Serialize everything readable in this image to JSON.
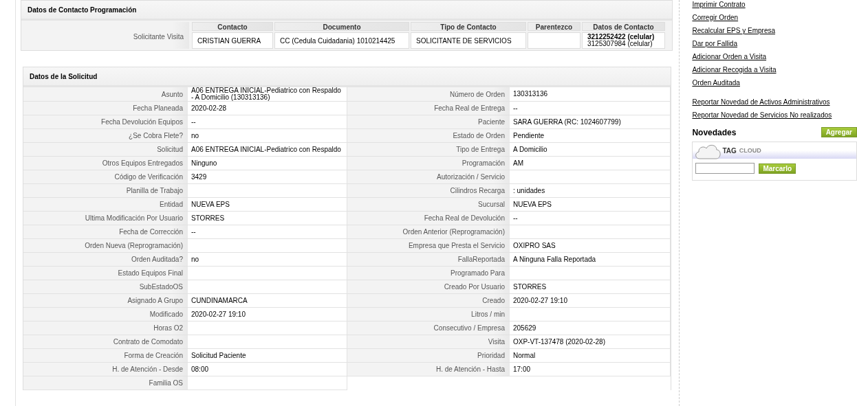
{
  "contact_section": {
    "title": "Datos de Contacto Programación",
    "row_label": "Solicitante Visita",
    "columns": [
      "Contacto",
      "Documento",
      "Tipo de Contacto",
      "Parentezco",
      "Datos de Contacto"
    ],
    "contact": {
      "name": "CRISTIAN GUERRA",
      "document": "CC (Cedula Cuidadania) 1010214425",
      "type": "SOLICITANTE DE SERVICIOS",
      "phones": [
        {
          "number": "3212252422 (celular)",
          "primary": true
        },
        {
          "number": "3125307984 (celular)",
          "primary": false
        }
      ]
    }
  },
  "request_section": {
    "title": "Datos de la Solicitud",
    "left_fields": [
      {
        "label": "Asunto",
        "value": "A06 ENTREGA INICIAL-Pediatrico con Respaldo - A Domicilio (130313136)"
      },
      {
        "label": "Fecha Planeada",
        "value": "2020-02-28"
      },
      {
        "label": "Fecha Devolución Equipos",
        "value": "--"
      },
      {
        "label": "¿Se Cobra Flete?",
        "value": "no"
      },
      {
        "label": "Solicitud",
        "value": "A06 ENTREGA INICIAL-Pediatrico con Respaldo"
      },
      {
        "label": "Otros Equipos Entregados",
        "value": "Ninguno"
      },
      {
        "label": "Código de Verificación",
        "value": "3429"
      },
      {
        "label": "Planilla de Trabajo"
      },
      {
        "label": "Entidad",
        "value": "NUEVA EPS"
      },
      {
        "label": "Ultima Modificación Por Usuario",
        "value": "STORRES"
      },
      {
        "label": "Fecha de Corrección",
        "value": "--"
      },
      {
        "label": "Orden Nueva (Reprogramación)"
      },
      {
        "label": "Orden Auditada?",
        "value": "no"
      },
      {
        "label": "Estado Equipos Final"
      },
      {
        "label": "SubEstadoOS"
      },
      {
        "label": "Asignado A Grupo",
        "value": "CUNDINAMARCA"
      },
      {
        "label": "Modificado",
        "value": "2020-02-27 19:10"
      },
      {
        "label": "Horas O2"
      },
      {
        "label": "Contrato de Comodato"
      },
      {
        "label": "Forma de Creación",
        "value": "Solicitud Paciente"
      },
      {
        "label": "H. de Atención - Desde",
        "value": "08:00"
      },
      {
        "label": "Familia OS"
      }
    ],
    "right_fields": [
      {
        "label": "Número de Orden",
        "value": "130313136"
      },
      {
        "label": "Fecha Real de Entrega",
        "value": "--"
      },
      {
        "label": "Paciente",
        "value": "SARA GUERRA (RC: 1024607799)"
      },
      {
        "label": "Estado de Orden",
        "value": "Pendiente"
      },
      {
        "label": "Tipo de Entrega",
        "value": "A Domicilio"
      },
      {
        "label": "Programación",
        "value": "AM"
      },
      {
        "label": "Autorización / Servicio"
      },
      {
        "label": "Cilindros Recarga",
        "value": ": unidades"
      },
      {
        "label": "Sucursal",
        "value": "NUEVA EPS"
      },
      {
        "label": "Fecha Real de Devolución",
        "value": "--"
      },
      {
        "label": "Orden Anterior (Reprogramación)"
      },
      {
        "label": "Empresa que Presta el Servicio",
        "value": "OXIPRO SAS"
      },
      {
        "label": "FallaReportada",
        "value": "A Ninguna Falla Reportada"
      },
      {
        "label": "Programado Para"
      },
      {
        "label": "Creado Por Usuario",
        "value": "STORRES"
      },
      {
        "label": "Creado",
        "value": "2020-02-27 19:10"
      },
      {
        "label": "Litros / min"
      },
      {
        "label": "Consecutivo / Empresa",
        "value": "205629"
      },
      {
        "label": "Visita",
        "value": "OXP-VT-137478 (2020-02-28)"
      },
      {
        "label": "Prioridad",
        "value": "Normal"
      },
      {
        "label": "H. de Atención - Hasta",
        "value": "17:00"
      }
    ]
  },
  "sidebar": {
    "link_groups": [
      [
        "Imprimir Contrato",
        "Corregir Orden",
        "Recalcular EPS y Empresa",
        "Dar por Fallida",
        "Adicionar Orden a Visita",
        "Adicionar Recogida a Visita",
        "Orden Auditada"
      ],
      [
        "Reportar Novedad de Activos Administrativos",
        "Reportar Novedad de Servicios No realizados"
      ]
    ],
    "news": {
      "title": "Novedades",
      "add_button": "Agregar"
    },
    "tag_cloud": {
      "title_main": "TAG",
      "title_sub": "CLOUD",
      "button": "Marcarlo"
    }
  }
}
